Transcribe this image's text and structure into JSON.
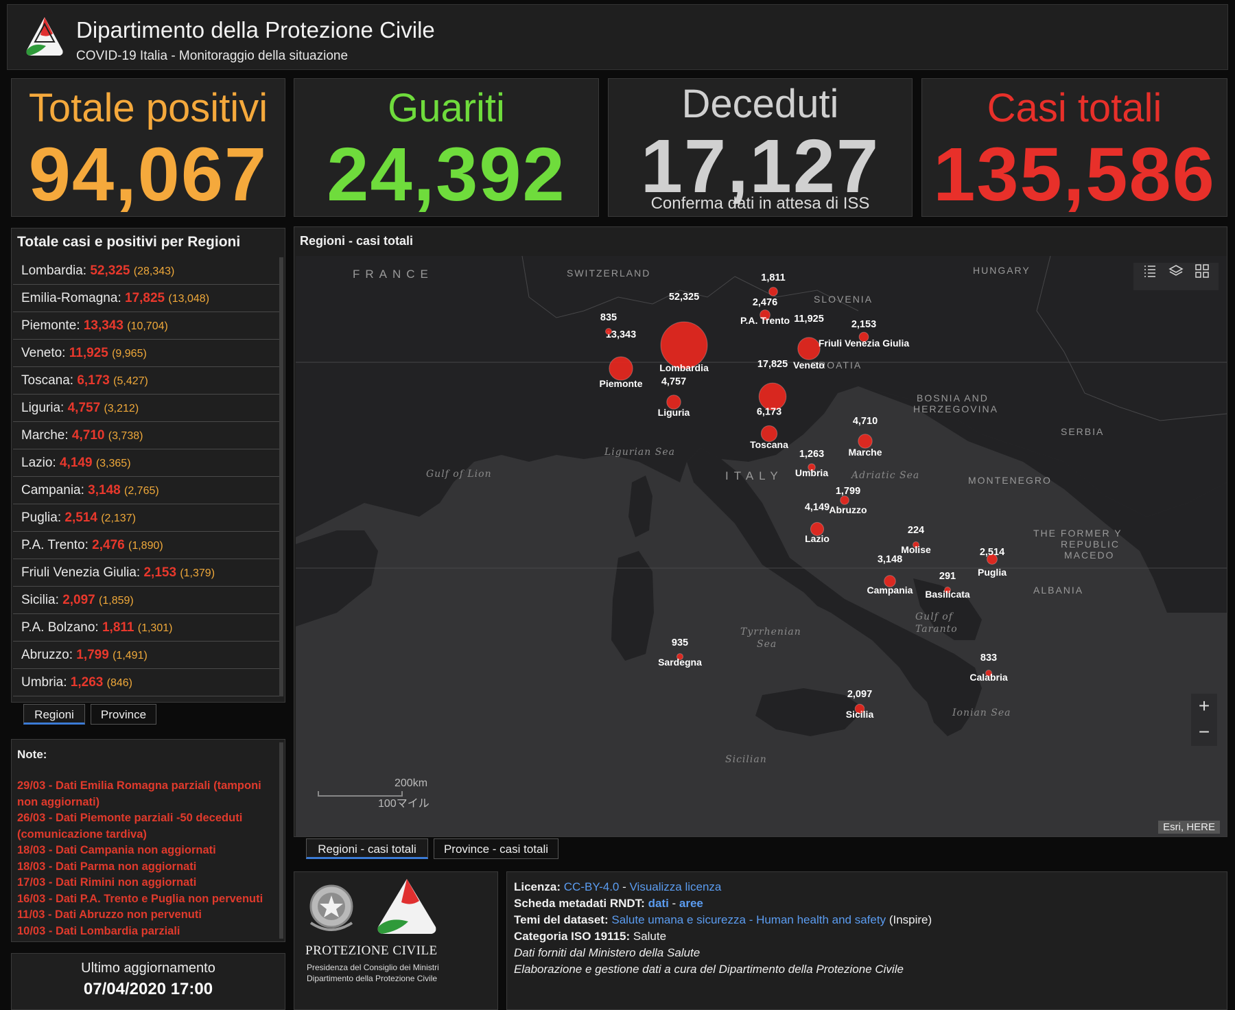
{
  "header": {
    "title": "Dipartimento della Protezione Civile",
    "subtitle": "COVID-19 Italia - Monitoraggio della situazione"
  },
  "counters": {
    "positivi": {
      "label": "Totale positivi",
      "value": "94,067",
      "color": "#f5a93c"
    },
    "guariti": {
      "label": "Guariti",
      "value": "24,392",
      "color": "#6fdc3c"
    },
    "deceduti": {
      "label": "Deceduti",
      "value": "17,127",
      "note": "Conferma dati in attesa di ISS",
      "color": "#d0d0d0"
    },
    "totali": {
      "label": "Casi totali",
      "value": "135,586",
      "color": "#e8302a"
    }
  },
  "region_list": {
    "title": "Totale casi e positivi per Regioni",
    "rows": [
      {
        "name": "Lombardia:",
        "total": "52,325",
        "positive": "28,343"
      },
      {
        "name": "Emilia-Romagna:",
        "total": "17,825",
        "positive": "13,048"
      },
      {
        "name": "Piemonte:",
        "total": "13,343",
        "positive": "10,704"
      },
      {
        "name": "Veneto:",
        "total": "11,925",
        "positive": "9,965"
      },
      {
        "name": "Toscana:",
        "total": "6,173",
        "positive": "5,427"
      },
      {
        "name": "Liguria:",
        "total": "4,757",
        "positive": "3,212"
      },
      {
        "name": "Marche:",
        "total": "4,710",
        "positive": "3,738"
      },
      {
        "name": "Lazio:",
        "total": "4,149",
        "positive": "3,365"
      },
      {
        "name": "Campania:",
        "total": "3,148",
        "positive": "2,765"
      },
      {
        "name": "Puglia:",
        "total": "2,514",
        "positive": "2,137"
      },
      {
        "name": "P.A. Trento:",
        "total": "2,476",
        "positive": "1,890"
      },
      {
        "name": "Friuli Venezia Giulia:",
        "total": "2,153",
        "positive": "1,379"
      },
      {
        "name": "Sicilia:",
        "total": "2,097",
        "positive": "1,859"
      },
      {
        "name": "P.A. Bolzano:",
        "total": "1,811",
        "positive": "1,301"
      },
      {
        "name": "Abruzzo:",
        "total": "1,799",
        "positive": "1,491"
      },
      {
        "name": "Umbria:",
        "total": "1,263",
        "positive": "846"
      }
    ],
    "tabs": [
      "Regioni",
      "Province"
    ]
  },
  "notes": {
    "title": "Note:",
    "items": [
      "29/03 - Dati  Emilia Romagna parziali (tamponi non aggiornati)",
      "26/03 - Dati Piemonte parziali -50 deceduti (comunicazione tardiva)",
      "18/03 - Dati Campania non aggiornati",
      "18/03 - Dati Parma non aggiornati",
      "17/03 - Dati Rimini non aggiornati",
      "16/03 - Dati P.A. Trento e Puglia non pervenuti",
      "11/03 - Dati Abruzzo non pervenuti",
      "10/03 - Dati Lombardia parziali"
    ]
  },
  "update": {
    "label": "Ultimo aggiornamento",
    "date": "07/04/2020 17:00"
  },
  "map": {
    "title": "Regioni - casi totali",
    "tabs": [
      "Regioni - casi totali",
      "Province - casi totali"
    ],
    "attribution": "Esri, HERE",
    "scale_km": "200km",
    "scale_mi": "100マイル",
    "zoom_in": "+",
    "zoom_out": "−",
    "country_labels": [
      "FRANCE",
      "SWITZERLAND",
      "HUNGARY",
      "SLOVENIA",
      "CROATIA",
      "BOSNIA AND",
      "HERZEGOVINA",
      "SERBIA",
      "MONTENEGRO",
      "ALBANIA",
      "THE FORMER Y",
      "REPUBLIC",
      "MACEDO",
      "ITALY"
    ],
    "sea_labels": [
      "Ligurian Sea",
      "Gulf of Lion",
      "Adriatic Sea",
      "Tyrrhenian",
      "Sea",
      "Gulf of",
      "Taranto",
      "Ionian Sea",
      "Sicilian"
    ],
    "points": [
      {
        "value": "52,325",
        "label": "Lombardia",
        "cases": 52325
      },
      {
        "value": "13,343",
        "label": "Piemonte",
        "cases": 13343
      },
      {
        "value": "835",
        "label": "",
        "cases": 835
      },
      {
        "value": "4,757",
        "label": "Liguria",
        "cases": 4757
      },
      {
        "value": "1,811",
        "label": "",
        "cases": 1811
      },
      {
        "value": "2,476",
        "label": "P.A. Trento",
        "cases": 2476
      },
      {
        "value": "11,925",
        "label": "Veneto",
        "cases": 11925
      },
      {
        "value": "2,153",
        "label": "Friuli Venezia Giulia",
        "cases": 2153
      },
      {
        "value": "17,825",
        "label": "",
        "cases": 17825
      },
      {
        "value": "6,173",
        "label": "Toscana",
        "cases": 6173
      },
      {
        "value": "4,710",
        "label": "Marche",
        "cases": 4710
      },
      {
        "value": "1,263",
        "label": "Umbria",
        "cases": 1263
      },
      {
        "value": "1,799",
        "label": "Abruzzo",
        "cases": 1799
      },
      {
        "value": "4,149",
        "label": "Lazio",
        "cases": 4149
      },
      {
        "value": "224",
        "label": "Molise",
        "cases": 224
      },
      {
        "value": "3,148",
        "label": "Campania",
        "cases": 3148
      },
      {
        "value": "291",
        "label": "Basilicata",
        "cases": 291
      },
      {
        "value": "2,514",
        "label": "Puglia",
        "cases": 2514
      },
      {
        "value": "935",
        "label": "Sardegna",
        "cases": 935
      },
      {
        "value": "833",
        "label": "Calabria",
        "cases": 833
      },
      {
        "value": "2,097",
        "label": "Sicilia",
        "cases": 2097
      }
    ]
  },
  "footer": {
    "logo_title": "PROTEZIONE CIVILE",
    "logo_sub1": "Presidenza del Consiglio dei Ministri",
    "logo_sub2": "Dipartimento della Protezione Civile",
    "licenza_label": "Licenza:",
    "licenza_link": "CC-BY-4.0",
    "licenza_sep": " - ",
    "licenza_view": "Visualizza licenza",
    "scheda_label": "Scheda metadati RNDT:",
    "scheda_dati": "dati",
    "scheda_sep": " - ",
    "scheda_aree": "aree",
    "temi_label": "Temi del dataset:",
    "temi_link": "Salute umana e sicurezza - Human health and safety",
    "temi_suffix": " (Inspire)",
    "iso_label": "Categoria ISO 19115:",
    "iso_value": " Salute",
    "dati_forniti": "Dati forniti dal Ministero della Salute",
    "elaborazione": "Elaborazione e gestione dati a cura del Dipartimento della Protezione Civile"
  }
}
